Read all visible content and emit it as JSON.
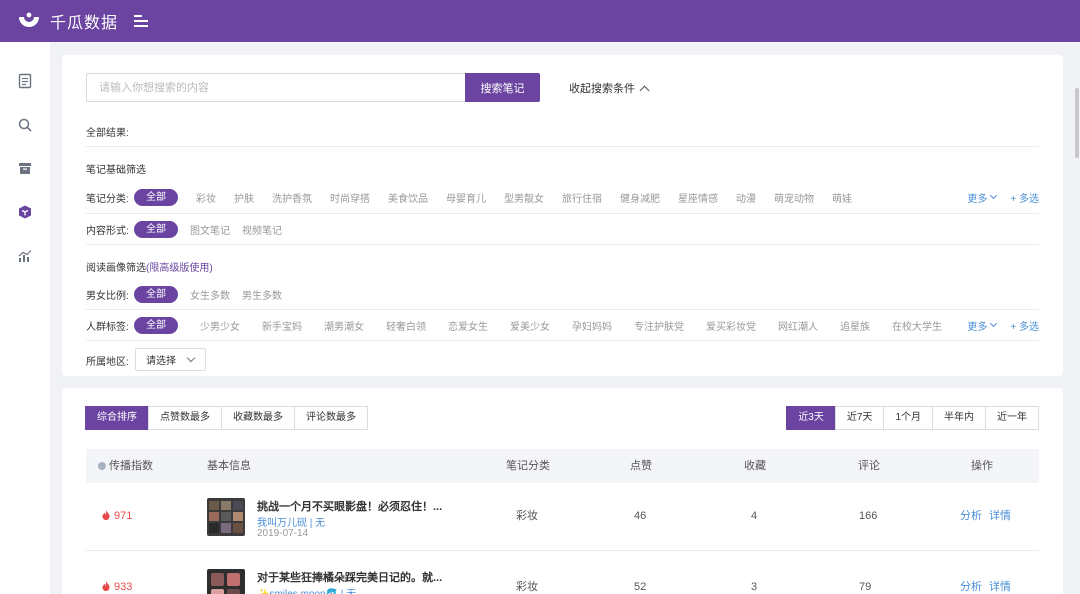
{
  "app": {
    "name": "千瓜数据"
  },
  "colors": {
    "brand": "#6a44a0",
    "link": "#4a8fd8",
    "hot": "#e84a4a"
  },
  "sidebar": {
    "items": [
      {
        "icon": "document-icon"
      },
      {
        "icon": "search-icon"
      },
      {
        "icon": "archive-icon"
      },
      {
        "icon": "cube-icon"
      },
      {
        "icon": "chart-icon"
      }
    ]
  },
  "search": {
    "placeholder": "请输入你想搜索的内容",
    "button": "搜索笔记",
    "collapse": "收起搜索条件"
  },
  "results_label": "全部结果:",
  "basic_section": {
    "title": "笔记基础筛选"
  },
  "category_row": {
    "label": "笔记分类:",
    "active": "全部",
    "options": [
      "彩妆",
      "护肤",
      "洗护香氛",
      "时尚穿搭",
      "美食饮品",
      "母婴育儿",
      "型男靓女",
      "旅行住宿",
      "健身减肥",
      "星座情感",
      "动漫",
      "萌宠动物",
      "萌娃"
    ],
    "more": "更多",
    "multi": "+ 多选"
  },
  "format_row": {
    "label": "内容形式:",
    "active": "全部",
    "options": [
      "图文笔记",
      "视频笔记"
    ]
  },
  "reader_section": {
    "title": "阅读画像筛选",
    "note": "(限高级版使用)"
  },
  "gender_row": {
    "label": "男女比例:",
    "active": "全部",
    "options": [
      "女生多数",
      "男生多数"
    ]
  },
  "crowd_row": {
    "label": "人群标签:",
    "active": "全部",
    "options": [
      "少男少女",
      "新手宝妈",
      "潮男潮女",
      "轻奢白领",
      "恋爱女生",
      "爱美少女",
      "孕妇妈妈",
      "专注护肤党",
      "爱买彩妆党",
      "网红潮人",
      "追星族",
      "在校大学生"
    ],
    "more": "更多",
    "multi": "+ 多选"
  },
  "region_row": {
    "label": "所属地区:",
    "select": "请选择"
  },
  "sort_tabs": [
    "综合排序",
    "点赞数最多",
    "收藏数最多",
    "评论数最多"
  ],
  "time_tabs": [
    "近3天",
    "近7天",
    "1个月",
    "半年内",
    "近一年"
  ],
  "table": {
    "headers": {
      "index": "传播指数",
      "info": "基本信息",
      "category": "笔记分类",
      "likes": "点赞",
      "collects": "收藏",
      "comments": "评论",
      "actions": "操作"
    },
    "rows": [
      {
        "index": "971",
        "title": "挑战一个月不买眼影盘！必须忍住！...",
        "author": "我叫万儿砚 | 无",
        "date": "2019-07-14",
        "category": "彩妆",
        "likes": "46",
        "collects": "4",
        "comments": "166",
        "analyze": "分析",
        "detail": "详情"
      },
      {
        "index": "933",
        "title": "对于某些狂捧橘朵踩完美日记的。就...",
        "author": "✨smiles moon🐬 | 无",
        "date": "",
        "category": "彩妆",
        "likes": "52",
        "collects": "3",
        "comments": "79",
        "analyze": "分析",
        "detail": "详情"
      }
    ]
  }
}
